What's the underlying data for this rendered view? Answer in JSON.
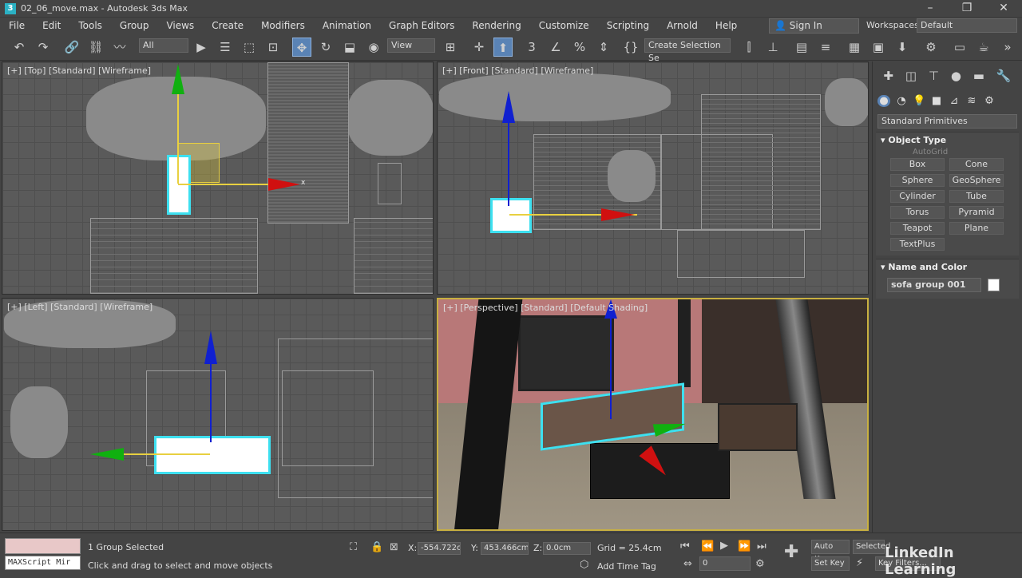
{
  "window": {
    "title": "02_06_move.max - Autodesk 3ds Max"
  },
  "menu": [
    "File",
    "Edit",
    "Tools",
    "Group",
    "Views",
    "Create",
    "Modifiers",
    "Animation",
    "Graph Editors",
    "Rendering",
    "Customize",
    "Scripting",
    "Arnold",
    "Help"
  ],
  "account": {
    "sign_in": "Sign In",
    "workspaces_label": "Workspaces:",
    "workspace_value": "Default"
  },
  "toolbar": {
    "filter_value": "All",
    "ref_coord_value": "View",
    "selection_set_placeholder": "Create Selection Se"
  },
  "viewports": {
    "top": "[+] [Top] [Standard] [Wireframe]",
    "front": "[+] [Front] [Standard] [Wireframe]",
    "left": "[+] [Left] [Standard] [Wireframe]",
    "perspective": "[+] [Perspective] [Standard] [Default Shading]"
  },
  "command_panel": {
    "category": "Standard Primitives",
    "object_type_header": "Object Type",
    "autogrid": "AutoGrid",
    "objects": [
      "Box",
      "Cone",
      "Sphere",
      "GeoSphere",
      "Cylinder",
      "Tube",
      "Torus",
      "Pyramid",
      "Teapot",
      "Plane",
      "TextPlus"
    ],
    "name_color_header": "Name and Color",
    "object_name": "sofa group 001"
  },
  "status": {
    "selection": "1 Group Selected",
    "prompt": "Click and drag to select and move objects",
    "maxscript": "MAXScript Mir",
    "x_label": "X:",
    "x_value": "-554.722cr",
    "y_label": "Y:",
    "y_value": "453.466cm",
    "z_label": "Z:",
    "z_value": "0.0cm",
    "grid": "Grid = 25.4cm",
    "add_time_tag": "Add Time Tag",
    "auto_key": "Auto Key",
    "set_key": "Set Key",
    "selected": "Selected",
    "key_filters": "Key Filters...",
    "frame": "0"
  },
  "watermark": "LinkedIn Learning",
  "colors": {
    "selection": "#3de0f0",
    "x_axis": "#d01010",
    "y_axis": "#10b010",
    "z_axis": "#1020d0"
  }
}
